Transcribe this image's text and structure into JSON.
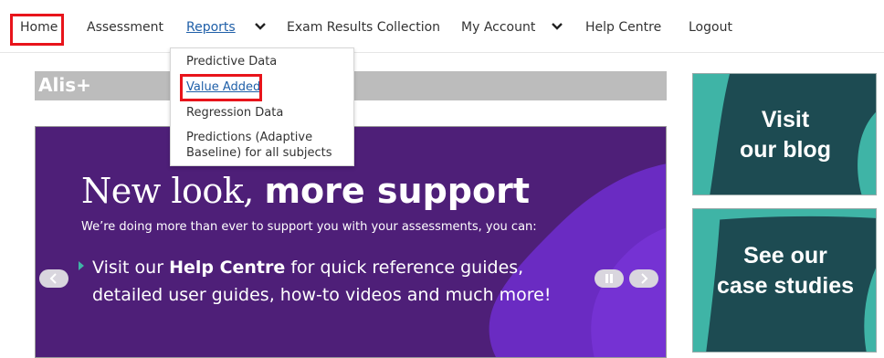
{
  "nav": {
    "home": "Home",
    "assessment": "Assessment",
    "reports": "Reports",
    "exam_results": "Exam Results Collection",
    "my_account": "My Account",
    "help_centre": "Help Centre",
    "logout": "Logout"
  },
  "reports_menu": {
    "items": [
      {
        "label": "Predictive Data"
      },
      {
        "label": "Value Added"
      },
      {
        "label": "Regression Data"
      },
      {
        "label_line1": "Predictions (Adaptive",
        "label_line2": "Baseline) for all subjects"
      }
    ]
  },
  "section": {
    "title": "Alis+"
  },
  "banner": {
    "title_light": "New look,",
    "title_bold": "more support",
    "subtitle": "We’re doing more than ever to support you with your assessments, you can:",
    "line1_pre": "Visit our",
    "line1_bold": "Help Centre",
    "line1_post": "for quick reference guides,",
    "line2": "detailed user guides, how-to videos and much more!"
  },
  "tiles": {
    "blog_line1": "Visit",
    "blog_line2": "our blog",
    "cases_line1": "See our",
    "cases_line2": "case studies"
  },
  "colors": {
    "highlight": "#e8141b",
    "link": "#1f5fa8",
    "banner_purple": "#4e1f78",
    "tile_teal": "#1d4b52",
    "tile_accent": "#3fb4a6"
  }
}
